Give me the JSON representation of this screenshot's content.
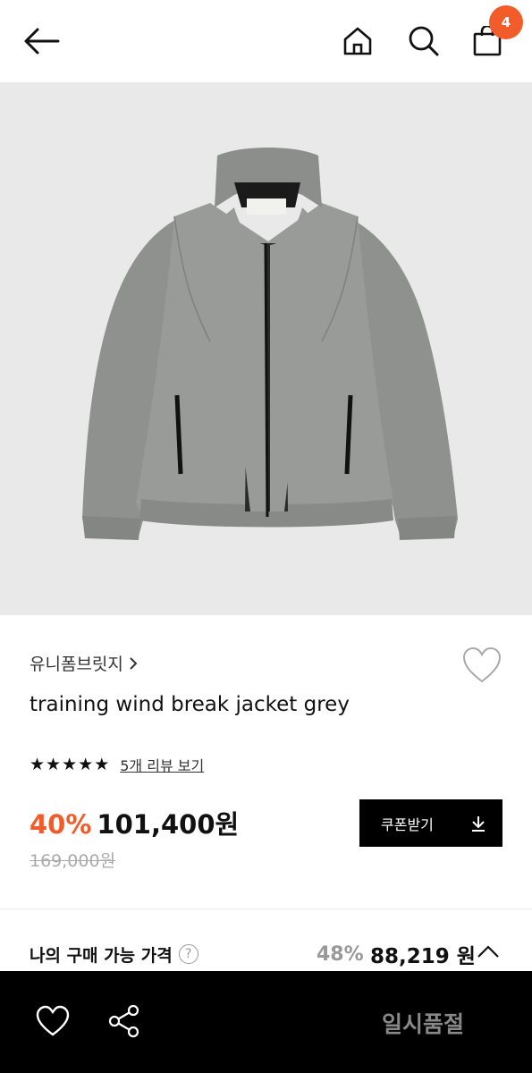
{
  "header": {
    "back_icon": "arrow-left-icon",
    "home_icon": "home-icon",
    "search_icon": "search-icon",
    "cart_icon": "shopping-bag-icon",
    "cart_count": "4",
    "accent_color": "#f25c2a"
  },
  "product": {
    "image": "grey-jacket-photo",
    "brand": "유니폼브릿지",
    "title": "training wind break jacket grey",
    "rating_stars": 5,
    "review_link": "5개 리뷰 보기",
    "discount": "40%",
    "price": "101,400원",
    "original_price": "169,000원",
    "coupon_label": "쿠폰받기"
  },
  "my_price": {
    "label": "나의 구매 가능 가격",
    "discount": "48%",
    "price": "88,219 원"
  },
  "bottom": {
    "wish_icon": "heart-outline-icon",
    "share_icon": "share-icon",
    "status": "일시품절"
  }
}
